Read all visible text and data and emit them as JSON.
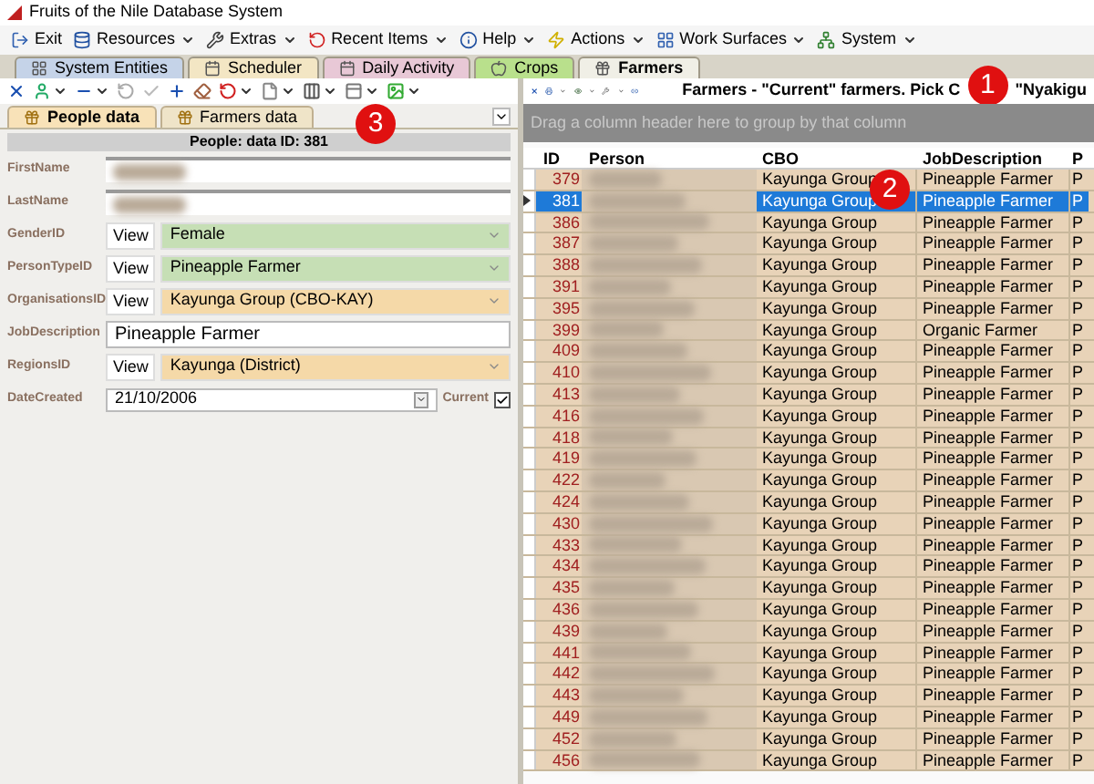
{
  "window": {
    "title": "Fruits of the Nile Database System"
  },
  "menu": [
    {
      "label": "Exit",
      "kind": "exit"
    },
    {
      "label": "Resources",
      "kind": "resources"
    },
    {
      "label": "Extras",
      "kind": "extras"
    },
    {
      "label": "Recent Items",
      "kind": "recent"
    },
    {
      "label": "Help",
      "kind": "help"
    },
    {
      "label": "Actions",
      "kind": "actions"
    },
    {
      "label": "Work Surfaces",
      "kind": "surfaces"
    },
    {
      "label": "System",
      "kind": "system"
    }
  ],
  "tabs": [
    {
      "label": "System Entities",
      "color": "#c5d3e8",
      "selected": false
    },
    {
      "label": "Scheduler",
      "color": "#f3e6c4",
      "selected": false
    },
    {
      "label": "Daily Activity",
      "color": "#e8c8d6",
      "selected": false
    },
    {
      "label": "Crops",
      "color": "#b9e08c",
      "selected": false
    },
    {
      "label": "Farmers",
      "color": "#f0efe6",
      "selected": true
    }
  ],
  "left": {
    "subtabs": [
      {
        "label": "People data",
        "selected": true
      },
      {
        "label": "Farmers data",
        "selected": false
      }
    ],
    "header": "People: data ID: 381",
    "badge": "3",
    "fields": [
      {
        "label": "FirstName",
        "kind": "blurred"
      },
      {
        "label": "LastName",
        "kind": "blurred"
      },
      {
        "label": "GenderID",
        "kind": "combo",
        "button": "View",
        "value": "Female",
        "color": "#c6dfb5"
      },
      {
        "label": "PersonTypeID",
        "kind": "combo",
        "button": "View",
        "value": "Pineapple Farmer",
        "color": "#c6dfb5"
      },
      {
        "label": "OrganisationsID",
        "kind": "combo",
        "button": "View",
        "value": "Kayunga Group (CBO-KAY)",
        "color": "#f5d9a8"
      },
      {
        "label": "JobDescription",
        "kind": "text",
        "value": "Pineapple Farmer"
      },
      {
        "label": "RegionsID",
        "kind": "combo",
        "button": "View",
        "value": "Kayunga (District)",
        "color": "#f5d9a8"
      },
      {
        "label": "DateCreated",
        "kind": "date",
        "value": "21/10/2006",
        "check_label": "Current",
        "checked": true
      }
    ]
  },
  "right": {
    "title_start": "Farmers - \"Current\" farmers. Pick C",
    "badge": "1",
    "title_end": "\"Nyakigu",
    "group_hint": "Drag a column header here to group by that column",
    "columns": [
      "ID",
      "Person",
      "CBO",
      "JobDescription",
      "P"
    ],
    "row_badge": "2",
    "rows": [
      {
        "id": "379",
        "cbo": "Kayunga Group",
        "job": "Pineapple Farmer",
        "column_5": "P",
        "selected": false
      },
      {
        "id": "381",
        "cbo": "Kayunga Group",
        "job": "Pineapple Farmer",
        "column_5": "P",
        "selected": true
      },
      {
        "id": "386",
        "cbo": "Kayunga Group",
        "job": "Pineapple Farmer",
        "column_5": "P",
        "selected": false
      },
      {
        "id": "387",
        "cbo": "Kayunga Group",
        "job": "Pineapple Farmer",
        "column_5": "P",
        "selected": false
      },
      {
        "id": "388",
        "cbo": "Kayunga Group",
        "job": "Pineapple Farmer",
        "column_5": "P",
        "selected": false
      },
      {
        "id": "391",
        "cbo": "Kayunga Group",
        "job": "Pineapple Farmer",
        "column_5": "P",
        "selected": false
      },
      {
        "id": "395",
        "cbo": "Kayunga Group",
        "job": "Pineapple Farmer",
        "column_5": "P",
        "selected": false
      },
      {
        "id": "399",
        "cbo": "Kayunga Group",
        "job": "Organic Farmer",
        "column_5": "P",
        "selected": false
      },
      {
        "id": "409",
        "cbo": "Kayunga Group",
        "job": "Pineapple Farmer",
        "column_5": "P",
        "selected": false
      },
      {
        "id": "410",
        "cbo": "Kayunga Group",
        "job": "Pineapple Farmer",
        "column_5": "P",
        "selected": false
      },
      {
        "id": "413",
        "cbo": "Kayunga Group",
        "job": "Pineapple Farmer",
        "column_5": "P",
        "selected": false
      },
      {
        "id": "416",
        "cbo": "Kayunga Group",
        "job": "Pineapple Farmer",
        "column_5": "P",
        "selected": false
      },
      {
        "id": "418",
        "cbo": "Kayunga Group",
        "job": "Pineapple Farmer",
        "column_5": "P",
        "selected": false
      },
      {
        "id": "419",
        "cbo": "Kayunga Group",
        "job": "Pineapple Farmer",
        "column_5": "P",
        "selected": false
      },
      {
        "id": "422",
        "cbo": "Kayunga Group",
        "job": "Pineapple Farmer",
        "column_5": "P",
        "selected": false
      },
      {
        "id": "424",
        "cbo": "Kayunga Group",
        "job": "Pineapple Farmer",
        "column_5": "P",
        "selected": false
      },
      {
        "id": "430",
        "cbo": "Kayunga Group",
        "job": "Pineapple Farmer",
        "column_5": "P",
        "selected": false
      },
      {
        "id": "433",
        "cbo": "Kayunga Group",
        "job": "Pineapple Farmer",
        "column_5": "P",
        "selected": false
      },
      {
        "id": "434",
        "cbo": "Kayunga Group",
        "job": "Pineapple Farmer",
        "column_5": "P",
        "selected": false
      },
      {
        "id": "435",
        "cbo": "Kayunga Group",
        "job": "Pineapple Farmer",
        "column_5": "P",
        "selected": false
      },
      {
        "id": "436",
        "cbo": "Kayunga Group",
        "job": "Pineapple Farmer",
        "column_5": "P",
        "selected": false
      },
      {
        "id": "439",
        "cbo": "Kayunga Group",
        "job": "Pineapple Farmer",
        "column_5": "P",
        "selected": false
      },
      {
        "id": "441",
        "cbo": "Kayunga Group",
        "job": "Pineapple Farmer",
        "column_5": "P",
        "selected": false
      },
      {
        "id": "442",
        "cbo": "Kayunga Group",
        "job": "Pineapple Farmer",
        "column_5": "P",
        "selected": false
      },
      {
        "id": "443",
        "cbo": "Kayunga Group",
        "job": "Pineapple Farmer",
        "column_5": "P",
        "selected": false
      },
      {
        "id": "449",
        "cbo": "Kayunga Group",
        "job": "Pineapple Farmer",
        "column_5": "P",
        "selected": false
      },
      {
        "id": "452",
        "cbo": "Kayunga Group",
        "job": "Pineapple Farmer",
        "column_5": "P",
        "selected": false
      },
      {
        "id": "456",
        "cbo": "Kayunga Group",
        "job": "Pineapple Farmer",
        "column_5": "P",
        "selected": false
      }
    ]
  }
}
